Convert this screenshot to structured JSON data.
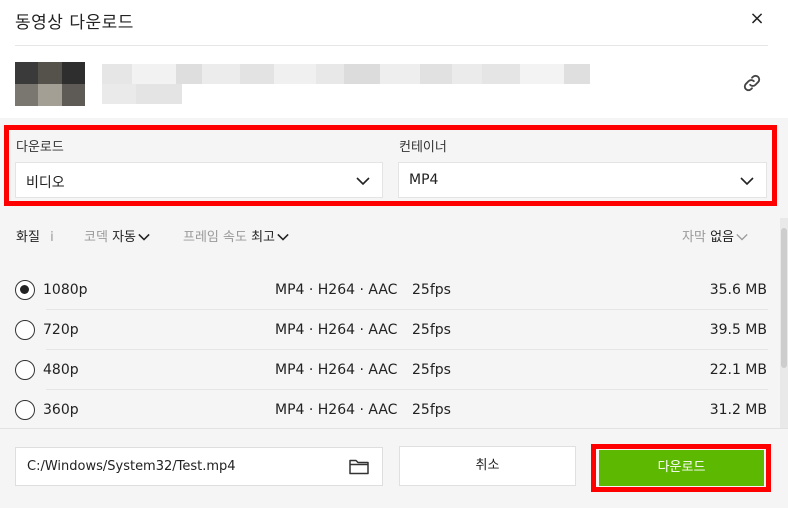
{
  "dialog": {
    "title": "동영상 다운로드",
    "close_label": "×"
  },
  "source": {
    "thumbnail_colors": [
      "#3a3a3a",
      "#55524c",
      "#2e2e2e",
      "#7a7670",
      "#a39f94",
      "#5e5b56"
    ],
    "url_blur_colors": [
      "#e6e6e6",
      "#f2f2f2",
      "#dedede",
      "#ececec",
      "#e3e3e3",
      "#f0f0f0",
      "#e8e8e8",
      "#dcdcdc",
      "#eeeeee",
      "#e1e1e1",
      "#ebebeb",
      "#e5e5e5",
      "#f3f3f3",
      "#dfdfdf",
      "#eaeaea",
      "#e4e4e4"
    ],
    "link_icon": "link-icon"
  },
  "download": {
    "label": "다운로드",
    "value": "비디오"
  },
  "container": {
    "label": "컨테이너",
    "value": "MP4"
  },
  "options": {
    "quality_label": "화질",
    "quality_info": "i",
    "codec_label": "코덱",
    "codec_value": "자동",
    "framerate_label": "프레임 속도",
    "framerate_value": "최고",
    "subtitle_label": "자막",
    "subtitle_value": "없음"
  },
  "qualities": [
    {
      "resolution": "1080p",
      "format": "MP4 · H264 · AAC",
      "fps": "25fps",
      "size": "35.6 MB",
      "selected": true
    },
    {
      "resolution": "720p",
      "format": "MP4 · H264 · AAC",
      "fps": "25fps",
      "size": "39.5 MB",
      "selected": false
    },
    {
      "resolution": "480p",
      "format": "MP4 · H264 · AAC",
      "fps": "25fps",
      "size": "22.1 MB",
      "selected": false
    },
    {
      "resolution": "360p",
      "format": "MP4 · H264 · AAC",
      "fps": "25fps",
      "size": "31.2 MB",
      "selected": false
    }
  ],
  "footer": {
    "save_path": "C:/Windows/System32/Test.mp4",
    "cancel_label": "취소",
    "download_label": "다운로드"
  },
  "colors": {
    "accent_green": "#5cb800",
    "highlight_red": "#ff0000"
  }
}
